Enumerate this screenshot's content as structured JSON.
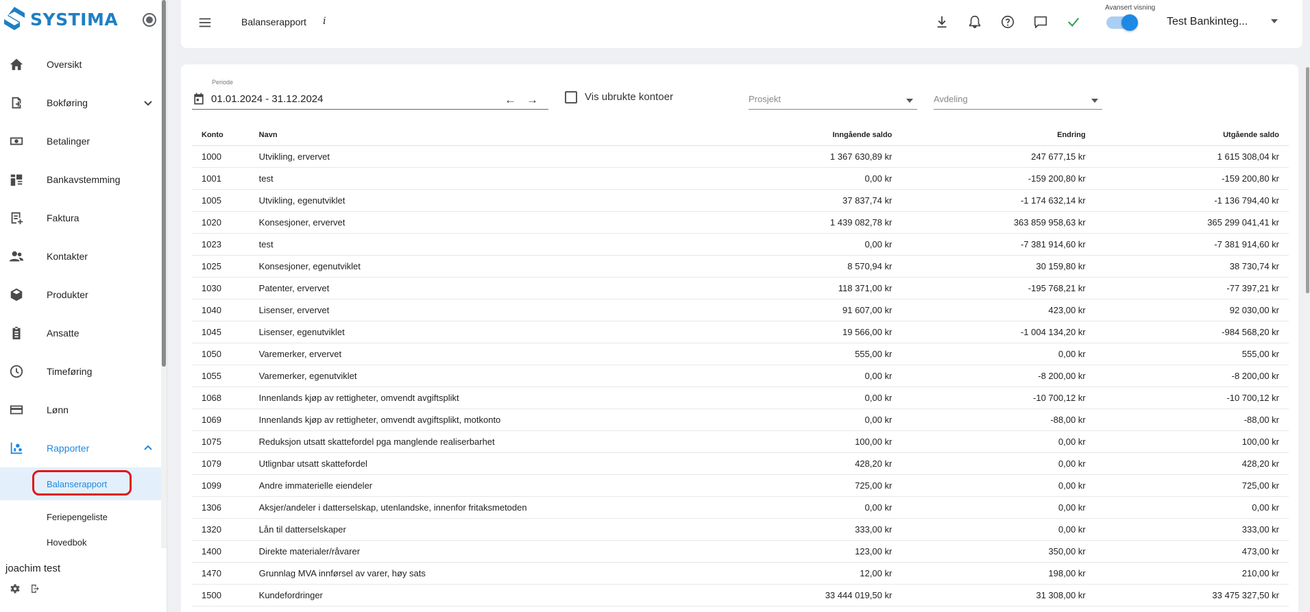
{
  "brand": {
    "name": "SYSTIMA",
    "color": "#1f7fc4"
  },
  "sidebar": {
    "items": [
      {
        "label": "Oversikt",
        "icon": "home-icon"
      },
      {
        "label": "Bokføring",
        "icon": "book-add-icon",
        "chevron": "down"
      },
      {
        "label": "Betalinger",
        "icon": "payments-icon"
      },
      {
        "label": "Bankavstemming",
        "icon": "bank-reconcile-icon"
      },
      {
        "label": "Faktura",
        "icon": "invoice-icon"
      },
      {
        "label": "Kontakter",
        "icon": "people-icon"
      },
      {
        "label": "Produkter",
        "icon": "box-icon"
      },
      {
        "label": "Ansatte",
        "icon": "badge-icon"
      },
      {
        "label": "Timeføring",
        "icon": "clock-icon"
      },
      {
        "label": "Lønn",
        "icon": "card-icon"
      },
      {
        "label": "Rapporter",
        "icon": "reports-icon",
        "chevron": "up",
        "active": true
      }
    ],
    "sub_items": [
      {
        "label": "Balanserapport",
        "selected": true
      },
      {
        "label": "Feriepengeliste"
      },
      {
        "label": "Hovedbok"
      }
    ],
    "user_name": "joachim test"
  },
  "topbar": {
    "title": "Balanserapport",
    "info": "i",
    "advanced_label": "Avansert visning",
    "advanced_on": true,
    "company": "Test Bankinteg..."
  },
  "filters": {
    "period_label": "Periode",
    "period_value": "01.01.2024 - 31.12.2024",
    "prev_arrow": "←",
    "next_arrow": "→",
    "unused_accounts_label": "Vis ubrukte kontoer",
    "project_placeholder": "Prosjekt",
    "department_placeholder": "Avdeling"
  },
  "table": {
    "headers": {
      "konto": "Konto",
      "navn": "Navn",
      "inngaende": "Inngående saldo",
      "endring": "Endring",
      "utgaende": "Utgående saldo"
    },
    "rows": [
      [
        "1000",
        "Utvikling, ervervet",
        "1 367 630,89 kr",
        "247 677,15 kr",
        "1 615 308,04 kr"
      ],
      [
        "1001",
        "test",
        "0,00 kr",
        "-159 200,80 kr",
        "-159 200,80 kr"
      ],
      [
        "1005",
        "Utvikling, egenutviklet",
        "37 837,74 kr",
        "-1 174 632,14 kr",
        "-1 136 794,40 kr"
      ],
      [
        "1020",
        "Konsesjoner, ervervet",
        "1 439 082,78 kr",
        "363 859 958,63 kr",
        "365 299 041,41 kr"
      ],
      [
        "1023",
        "test",
        "0,00 kr",
        "-7 381 914,60 kr",
        "-7 381 914,60 kr"
      ],
      [
        "1025",
        "Konsesjoner, egenutviklet",
        "8 570,94 kr",
        "30 159,80 kr",
        "38 730,74 kr"
      ],
      [
        "1030",
        "Patenter, ervervet",
        "118 371,00 kr",
        "-195 768,21 kr",
        "-77 397,21 kr"
      ],
      [
        "1040",
        "Lisenser, ervervet",
        "91 607,00 kr",
        "423,00 kr",
        "92 030,00 kr"
      ],
      [
        "1045",
        "Lisenser, egenutviklet",
        "19 566,00 kr",
        "-1 004 134,20 kr",
        "-984 568,20 kr"
      ],
      [
        "1050",
        "Varemerker, ervervet",
        "555,00 kr",
        "0,00 kr",
        "555,00 kr"
      ],
      [
        "1055",
        "Varemerker, egenutviklet",
        "0,00 kr",
        "-8 200,00 kr",
        "-8 200,00 kr"
      ],
      [
        "1068",
        "Innenlands kjøp av rettigheter, omvendt avgiftsplikt",
        "0,00 kr",
        "-10 700,12 kr",
        "-10 700,12 kr"
      ],
      [
        "1069",
        "Innenlands kjøp av rettigheter, omvendt avgiftsplikt, motkonto",
        "0,00 kr",
        "-88,00 kr",
        "-88,00 kr"
      ],
      [
        "1075",
        "Reduksjon utsatt skattefordel pga manglende realiserbarhet",
        "100,00 kr",
        "0,00 kr",
        "100,00 kr"
      ],
      [
        "1079",
        "Utlignbar utsatt skattefordel",
        "428,20 kr",
        "0,00 kr",
        "428,20 kr"
      ],
      [
        "1099",
        "Andre immaterielle eiendeler",
        "725,00 kr",
        "0,00 kr",
        "725,00 kr"
      ],
      [
        "1306",
        "Aksjer/andeler i datterselskap, utenlandske, innenfor fritaksmetoden",
        "0,00 kr",
        "0,00 kr",
        "0,00 kr"
      ],
      [
        "1320",
        "Lån til datterselskaper",
        "333,00 kr",
        "0,00 kr",
        "333,00 kr"
      ],
      [
        "1400",
        "Direkte materialer/råvarer",
        "123,00 kr",
        "350,00 kr",
        "473,00 kr"
      ],
      [
        "1470",
        "Grunnlag MVA innførsel av varer, høy sats",
        "12,00 kr",
        "198,00 kr",
        "210,00 kr"
      ],
      [
        "1500",
        "Kundefordringer",
        "33 444 019,50 kr",
        "31 308,00 kr",
        "33 475 327,50 kr"
      ]
    ]
  },
  "colors": {
    "accent": "#1e88e5",
    "highlight": "#e3151a",
    "check": "#2e9e4f"
  }
}
